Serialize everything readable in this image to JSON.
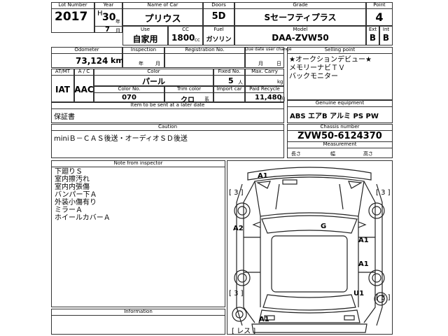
{
  "header": {
    "lot_label": "Lot Number",
    "lot_value": "2017",
    "year_label": "Year",
    "year_era": "H",
    "year_value": "30",
    "year_suffix": "年",
    "month_value": "7",
    "month_suffix": "月",
    "name_label": "Name of Car",
    "name_value": "プリウス",
    "doors_label": "Doors",
    "doors_value": "5D",
    "grade_label": "Grade",
    "grade_value": "Sセーフティプラス",
    "point_label": "Point",
    "point_value": "4",
    "use_label": "Use",
    "use_value": "自家用",
    "cc_label": "CC",
    "cc_value": "1800",
    "cc_unit": "cc",
    "fuel_label": "Fuel",
    "fuel_value": "ガソリン",
    "model_label": "Model",
    "model_value": "DAA-ZVW50",
    "ext_label": "Ext",
    "ext_value": "B",
    "int_label": "Int",
    "int_value": "B"
  },
  "row2": {
    "odometer_label": "Odometer",
    "odometer_value": "73,124",
    "odometer_unit": "km",
    "inspection_label": "Inspection",
    "inspection_year": "年",
    "inspection_month": "月",
    "registration_label": "Registration No.",
    "due_label": "Due date user change",
    "due_month": "月",
    "due_day": "日",
    "selling_label": "Selling point",
    "selling_text": "★オークションデビュー★\nメモリーナビＴＶ\nバックモニター"
  },
  "row3": {
    "atmt_label": "AT/MT",
    "atmt_value": "IAT",
    "ac_label": "A / C",
    "ac_value": "AAC",
    "color_label": "Color",
    "color_value": "パール",
    "fixed_label": "Fixed No.",
    "fixed_value": "5",
    "fixed_unit": "人",
    "max_label": "Max. Carry",
    "max_unit": "kg",
    "colorno_label": "Color No.",
    "colorno_value": "070",
    "trim_label": "Trim color",
    "trim_value": "クロ",
    "trim_suffix": "系",
    "import_label": "Import car",
    "recycle_label": "Paid Recycle",
    "recycle_value": "11,480",
    "recycle_unit": "円",
    "items_label": "Item to be sent at a later date",
    "items_value": "保証書",
    "equipment_label": "Genuine equipment",
    "equipment_value": "ABS エアB アルミ PS PW"
  },
  "caution": {
    "label": "Caution",
    "value": "miniＢ－ＣＡＳ後送・オーディオＳＤ後送",
    "chassis_label": "Chassis number",
    "chassis_value": "ZVW50-6124370",
    "measure_label": "Measurement",
    "length": "長さ",
    "width": "幅",
    "height": "高さ"
  },
  "inspector": {
    "label": "Note from inspector",
    "text": "下廻りＳ\n室内擦汚れ\n室内内張傷\nバンパー下Ａ\n外装小傷有り\nミラーＡ\nホイールカバーＡ"
  },
  "information": {
    "label": "Information"
  },
  "diagram": {
    "a1_top": "A1",
    "a2": "A2",
    "g": "G",
    "a1_right1": "A1",
    "a1_right2": "A1",
    "u1": "U1",
    "a1_bottom": "A1",
    "bracket_tl": "[ 3 ]",
    "bracket_tr": "[ 3 ]",
    "bracket_ml": "[ 3 ]",
    "bracket_br": "[ 3 ]",
    "bracket_rear": "[ レス ]"
  }
}
